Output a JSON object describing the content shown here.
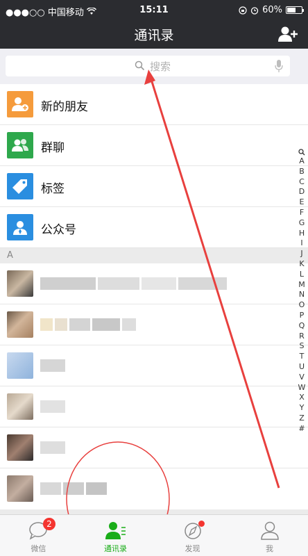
{
  "status": {
    "carrier": "●●●○○ 中国移动",
    "time": "15:11",
    "battery": "60%",
    "battery_level": 0.6
  },
  "nav": {
    "title": "通讯录"
  },
  "search": {
    "placeholder": "搜索"
  },
  "entries": [
    {
      "label": "新的朋友",
      "icon": "new-friends-icon",
      "color": "#f59b3c"
    },
    {
      "label": "群聊",
      "icon": "group-chat-icon",
      "color": "#2ea84c"
    },
    {
      "label": "标签",
      "icon": "tag-icon",
      "color": "#2a8ee0"
    },
    {
      "label": "公众号",
      "icon": "official-account-icon",
      "color": "#2a8ee0"
    }
  ],
  "section_letter": "A",
  "index": [
    "A",
    "B",
    "C",
    "D",
    "E",
    "F",
    "G",
    "H",
    "I",
    "J",
    "K",
    "L",
    "M",
    "N",
    "O",
    "P",
    "Q",
    "R",
    "S",
    "T",
    "U",
    "V",
    "W",
    "X",
    "Y",
    "Z",
    "#"
  ],
  "tabs": [
    {
      "label": "微信",
      "badge": "2"
    },
    {
      "label": "通讯录"
    },
    {
      "label": "发现"
    },
    {
      "label": "我"
    }
  ],
  "colors": {
    "accent": "#1aad19",
    "annotation": "#e8403e",
    "header": "#2b2c30"
  }
}
